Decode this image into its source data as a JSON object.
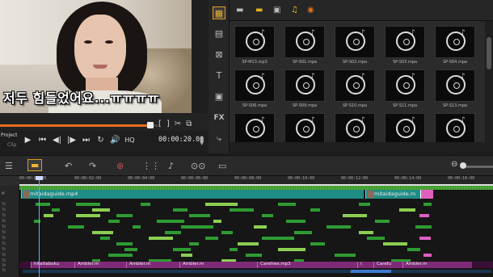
{
  "preview": {
    "subtitle": "저두 힘들었어요...ㅠㅠㅠㅠ"
  },
  "playback": {
    "project_label": "Project",
    "clip_label": "Clip",
    "timecode": "00:00:20.00",
    "hq_label": "HQ",
    "scrub_fraction": 0.72,
    "icons": [
      "play-icon",
      "start-icon",
      "prev-frame-icon",
      "next-frame-icon",
      "end-icon",
      "repeat-icon",
      "volume-icon"
    ]
  },
  "library": {
    "tiles": [
      {
        "label": "SP-M13.mp3"
      },
      {
        "label": "SP-S01.mpa"
      },
      {
        "label": "SP-S02.mpa"
      },
      {
        "label": "SP-S03.mpa"
      },
      {
        "label": "SP-S04.mpa"
      },
      {
        "label": "SP-S06.mpa"
      },
      {
        "label": "SP-S09.mpa"
      },
      {
        "label": "SP-S10.mpa"
      },
      {
        "label": "SP-S11.mpa"
      },
      {
        "label": "SP-S13.mpa"
      },
      {
        "label": ""
      },
      {
        "label": ""
      },
      {
        "label": ""
      },
      {
        "label": ""
      },
      {
        "label": ""
      }
    ]
  },
  "ruler": {
    "ticks": [
      "00:00:00:00",
      "00:00:02:00",
      "00:00:04:00",
      "00:00:06:00",
      "00:00:08:00",
      "00:00:10:00",
      "00:00:12:00",
      "00:00:14:00",
      "00:00:16:00"
    ]
  },
  "timeline": {
    "video_clips": [
      {
        "label": "mitaidaguide.mp4"
      },
      {
        "label": "mitaidaguide.m"
      }
    ],
    "music_clips": [
      {
        "label": "hitaitaboku"
      },
      {
        "label": "Ambler.m"
      },
      {
        "label": "Ambler.m"
      },
      {
        "label": "Ambler.m"
      },
      {
        "label": "Carefree.mp3"
      },
      {
        "label": "("
      },
      {
        "label": "Carefu"
      },
      {
        "label": "Ambler.m"
      }
    ],
    "track_labels": [
      "Tit",
      "Tit",
      "Tit",
      "Tit",
      "Tit",
      "Tit",
      "Tit",
      "Tit",
      "Tit",
      "Tit",
      "Tit",
      "Tit",
      "Tit",
      "Tit",
      "Tit"
    ]
  }
}
